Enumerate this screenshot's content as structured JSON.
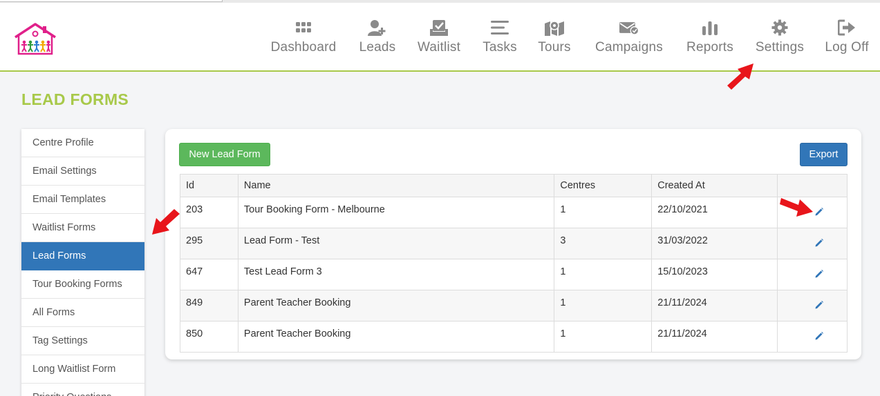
{
  "nav": {
    "items": [
      {
        "label": "Dashboard",
        "icon": "grid-icon"
      },
      {
        "label": "Leads",
        "icon": "user-add-icon"
      },
      {
        "label": "Waitlist",
        "icon": "checkbox-tray-icon"
      },
      {
        "label": "Tasks",
        "icon": "lines-icon"
      },
      {
        "label": "Tours",
        "icon": "map-icon"
      },
      {
        "label": "Campaigns",
        "icon": "envelope-check-icon"
      },
      {
        "label": "Reports",
        "icon": "bar-chart-icon"
      },
      {
        "label": "Settings",
        "icon": "gear-icon"
      },
      {
        "label": "Log Off",
        "icon": "logout-icon"
      }
    ]
  },
  "page": {
    "title": "LEAD FORMS"
  },
  "sidebar": {
    "items": [
      {
        "label": "Centre Profile",
        "active": false
      },
      {
        "label": "Email Settings",
        "active": false
      },
      {
        "label": "Email Templates",
        "active": false
      },
      {
        "label": "Waitlist Forms",
        "active": false
      },
      {
        "label": "Lead Forms",
        "active": true
      },
      {
        "label": "Tour Booking Forms",
        "active": false
      },
      {
        "label": "All Forms",
        "active": false
      },
      {
        "label": "Tag Settings",
        "active": false
      },
      {
        "label": "Long Waitlist Form",
        "active": false
      },
      {
        "label": "Priority Questions",
        "active": false
      }
    ]
  },
  "toolbar": {
    "new_label": "New Lead Form",
    "export_label": "Export"
  },
  "table": {
    "columns": [
      "Id",
      "Name",
      "Centres",
      "Created At",
      ""
    ],
    "rows": [
      {
        "id": "203",
        "name": "Tour Booking Form - Melbourne",
        "centres": "1",
        "created": "22/10/2021"
      },
      {
        "id": "295",
        "name": "Lead Form - Test",
        "centres": "3",
        "created": "31/03/2022"
      },
      {
        "id": "647",
        "name": "Test Lead Form 3",
        "centres": "1",
        "created": "15/10/2023"
      },
      {
        "id": "849",
        "name": "Parent Teacher Booking",
        "centres": "1",
        "created": "21/11/2024"
      },
      {
        "id": "850",
        "name": "Parent Teacher Booking",
        "centres": "1",
        "created": "21/11/2024"
      }
    ]
  },
  "colors": {
    "accent_green": "#a8c94a",
    "primary_blue": "#3176b8",
    "success_green": "#5cb85c",
    "annotation_red": "#e8151b"
  }
}
